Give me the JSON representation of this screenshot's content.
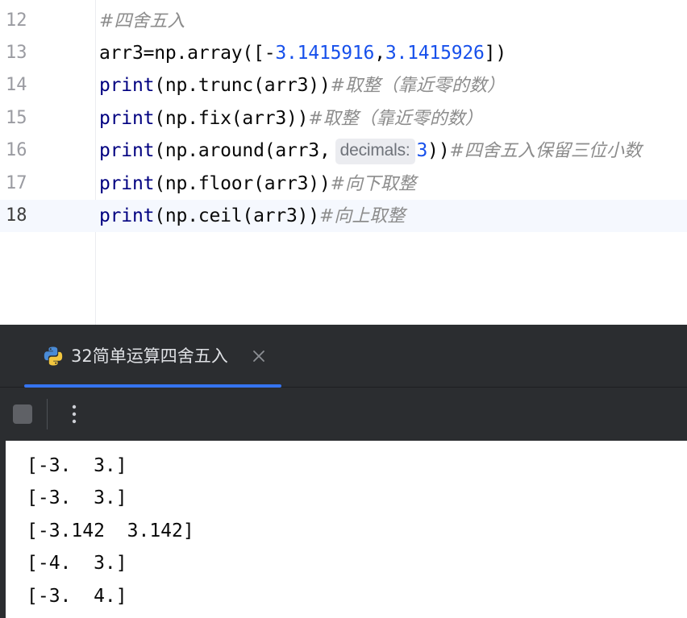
{
  "editor": {
    "lines": [
      {
        "number": "12",
        "comment": "#四舍五入"
      },
      {
        "number": "13",
        "prefix": "arr3=np.array([-",
        "num1": "3.1415916",
        "sep": ",",
        "num2": "3.1415926",
        "suffix": "])"
      },
      {
        "number": "14",
        "kw": "print",
        "code": "(np.trunc(arr3))",
        "comment": "#取整（靠近零的数）"
      },
      {
        "number": "15",
        "kw": "print",
        "code": "(np.fix(arr3))",
        "comment": "#取整（靠近零的数）"
      },
      {
        "number": "16",
        "kw": "print",
        "code": "(np.around(arr3,",
        "hint": "decimals:",
        "num": "3",
        "code_end": "))",
        "comment": "#四舍五入保留三位小数"
      },
      {
        "number": "17",
        "kw": "print",
        "code": "(np.floor(arr3))",
        "comment": "#向下取整"
      },
      {
        "number": "18",
        "kw": "print",
        "code": "(np.ceil(arr3))",
        "comment": "#向上取整"
      }
    ]
  },
  "run": {
    "tab_label": "32简单运算四舍五入",
    "icons": {
      "tab": "python-icon",
      "close": "close-icon",
      "stop": "stop-icon",
      "more": "more-vertical-icon"
    },
    "output": [
      "[-3.  3.]",
      "[-3.  3.]",
      "[-3.142  3.142]",
      "[-4.  3.]",
      "[-3.  4.]"
    ]
  },
  "colors": {
    "accent": "#3574f0",
    "keyword": "#000080",
    "number": "#1750eb",
    "comment": "#8c8c8c",
    "panel_bg": "#2b2d30"
  }
}
